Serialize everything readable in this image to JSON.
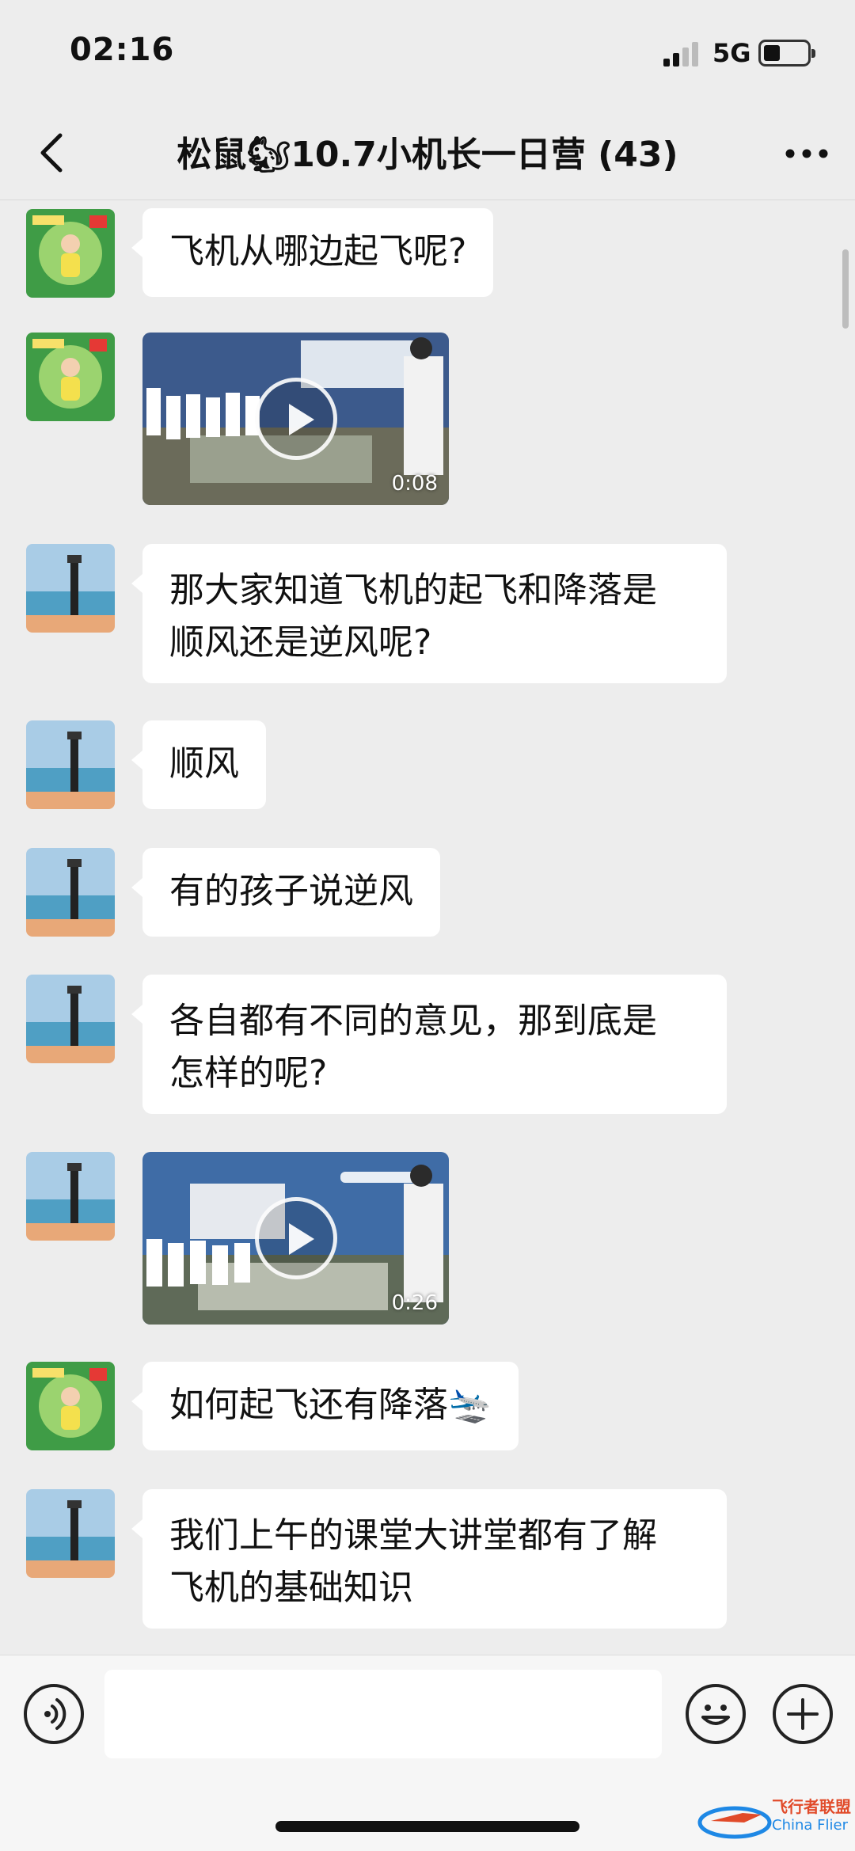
{
  "status_bar": {
    "time": "02:16",
    "network": "5G"
  },
  "header": {
    "title": "松鼠🐿10.7小机长一日营 (43)"
  },
  "messages": [
    {
      "type": "text",
      "sender": "teacher",
      "text": "飞机从哪边起飞呢?"
    },
    {
      "type": "video",
      "sender": "teacher",
      "duration": "0:08"
    },
    {
      "type": "text",
      "sender": "parent",
      "lines": [
        "那大家知道飞机的起飞和降落是",
        "顺风还是逆风呢?"
      ]
    },
    {
      "type": "text",
      "sender": "parent",
      "text": "顺风"
    },
    {
      "type": "text",
      "sender": "parent",
      "text": "有的孩子说逆风"
    },
    {
      "type": "text",
      "sender": "parent",
      "lines": [
        "各自都有不同的意见，那到底是",
        "怎样的呢?"
      ]
    },
    {
      "type": "video",
      "sender": "parent",
      "duration": "0:26"
    },
    {
      "type": "text",
      "sender": "teacher",
      "text": "如何起飞还有降落🛬"
    },
    {
      "type": "text",
      "sender": "parent",
      "lines": [
        "我们上午的课堂大讲堂都有了解",
        "飞机的基础知识"
      ]
    }
  ],
  "watermark": {
    "line1": "飞行者联盟",
    "line2": "China Flier"
  },
  "colors": {
    "background": "#ededed",
    "bubble": "#ffffff",
    "input_bar": "#f6f6f6"
  }
}
